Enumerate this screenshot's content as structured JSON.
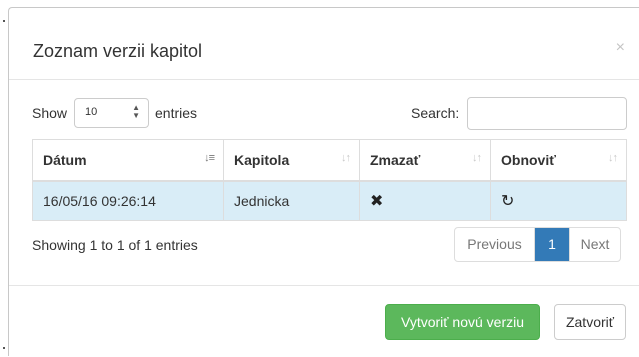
{
  "modal": {
    "title": "Zoznam verzii kapitol",
    "close_symbol": "×"
  },
  "controls": {
    "show_label": "Show",
    "length_value": "10",
    "entries_label": "entries",
    "search_label": "Search:",
    "search_value": ""
  },
  "table": {
    "columns": [
      {
        "label": "Dátum",
        "sort_icon": "sort-amount-asc-icon",
        "sort_glyph": "↓≡",
        "active": true
      },
      {
        "label": "Kapitola",
        "sort_icon": "sort-both-icon",
        "sort_glyph": "↓↑"
      },
      {
        "label": "Zmazať",
        "sort_icon": "sort-both-icon",
        "sort_glyph": "↓↑"
      },
      {
        "label": "Obnoviť",
        "sort_icon": "sort-both-icon",
        "sort_glyph": "↓↑"
      }
    ],
    "rows": [
      {
        "datum": "16/05/16 09:26:14",
        "kapitola": "Jednicka",
        "zmazat_icon": "delete-x-icon",
        "zmazat_glyph": "✖",
        "obnovit_icon": "refresh-icon",
        "obnovit_glyph": "↻"
      }
    ]
  },
  "info": "Showing 1 to 1 of 1 entries",
  "pagination": {
    "previous": "Previous",
    "current_page": "1",
    "next": "Next"
  },
  "footer": {
    "create_button": "Vytvoriť novú verziu",
    "close_button": "Zatvoriť"
  },
  "colors": {
    "primary": "#337ab7",
    "success": "#5cb85c",
    "selected_row": "#d9edf7"
  }
}
